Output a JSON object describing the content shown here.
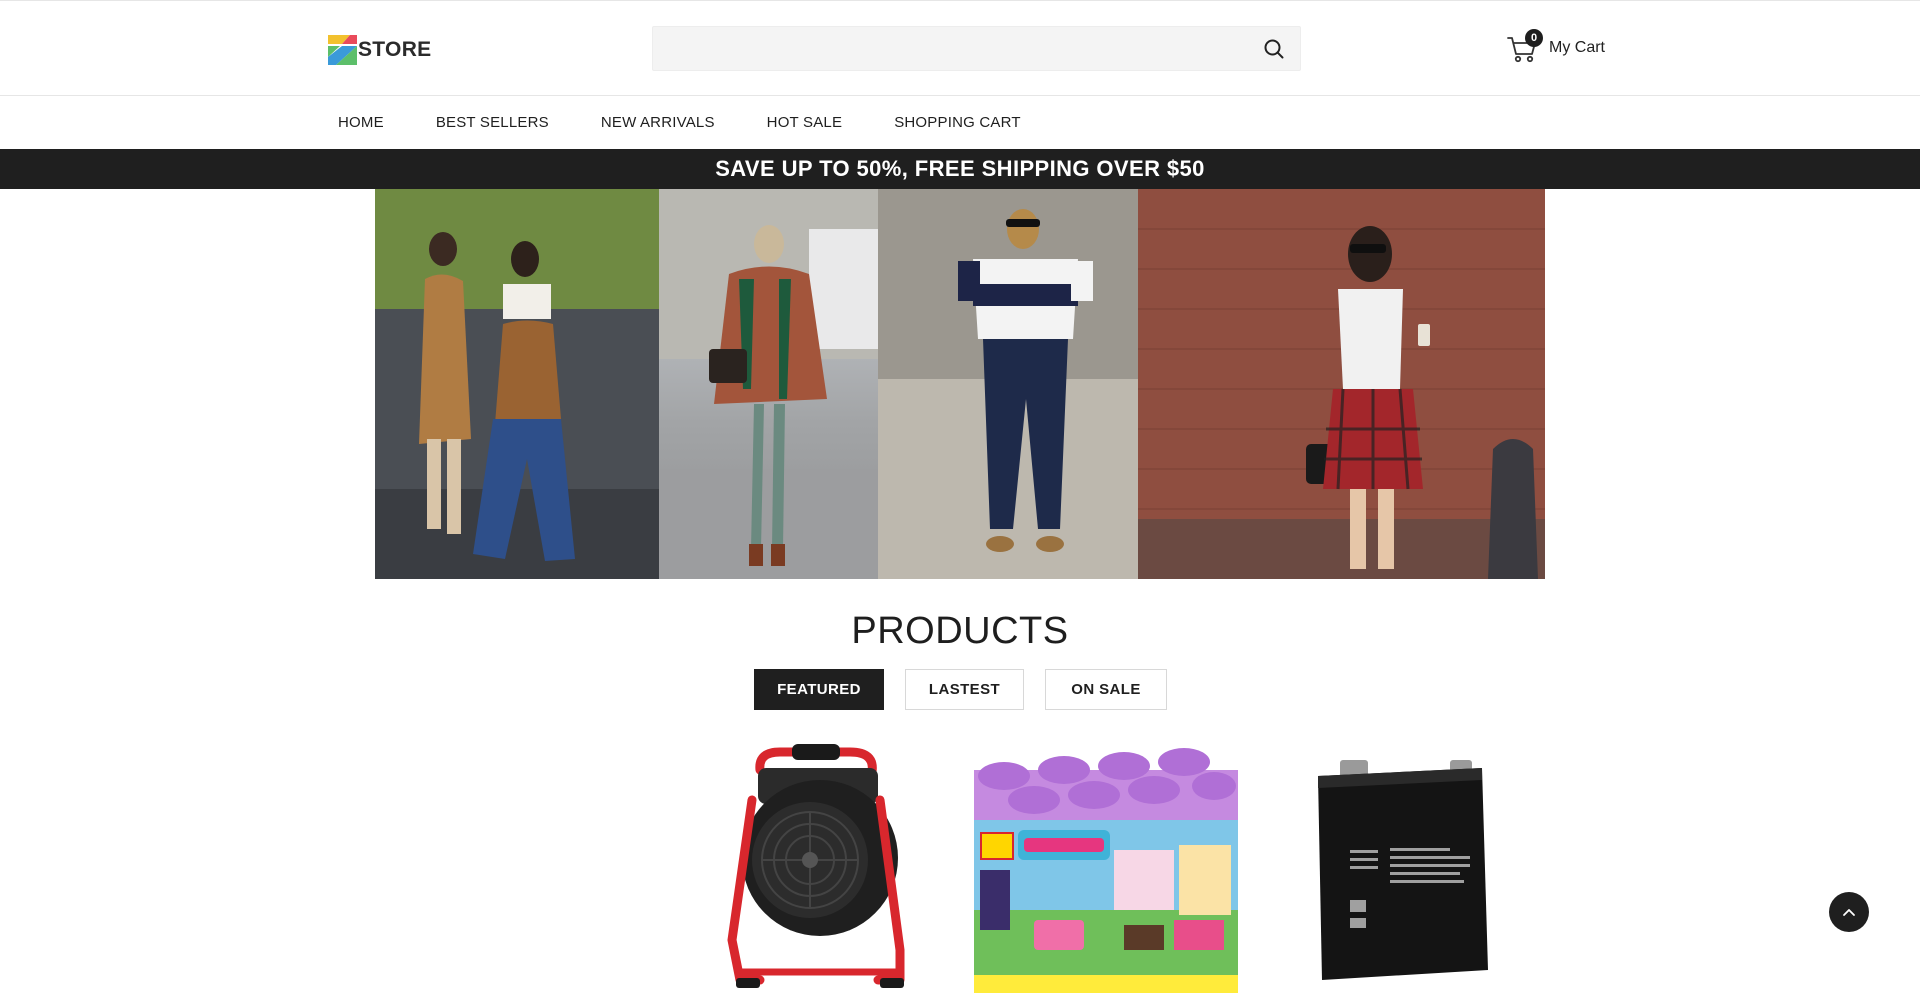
{
  "header": {
    "logo_text": "STORE",
    "search": {
      "value": "",
      "placeholder": ""
    },
    "cart": {
      "count": "0",
      "label": "My Cart"
    }
  },
  "nav": {
    "items": [
      {
        "label": "HOME"
      },
      {
        "label": "BEST SELLERS"
      },
      {
        "label": "NEW ARRIVALS"
      },
      {
        "label": "HOT SALE"
      },
      {
        "label": "SHOPPING CART"
      }
    ]
  },
  "promo": {
    "text": "SAVE UP TO 50%, FREE SHIPPING OVER $50"
  },
  "products_section": {
    "title": "PRODUCTS",
    "tabs": [
      {
        "label": "FEATURED",
        "active": true
      },
      {
        "label": "LASTEST",
        "active": false
      },
      {
        "label": "ON SALE",
        "active": false
      }
    ]
  },
  "colors": {
    "dark": "#1f1f1f",
    "logo_yellow": "#f2c12e",
    "logo_green": "#5cbf6a",
    "logo_blue": "#3a9ad9",
    "logo_red": "#e94b5b",
    "heater_red": "#d8272d"
  },
  "icons": [
    "search-icon",
    "cart-icon",
    "chevron-up-icon"
  ]
}
